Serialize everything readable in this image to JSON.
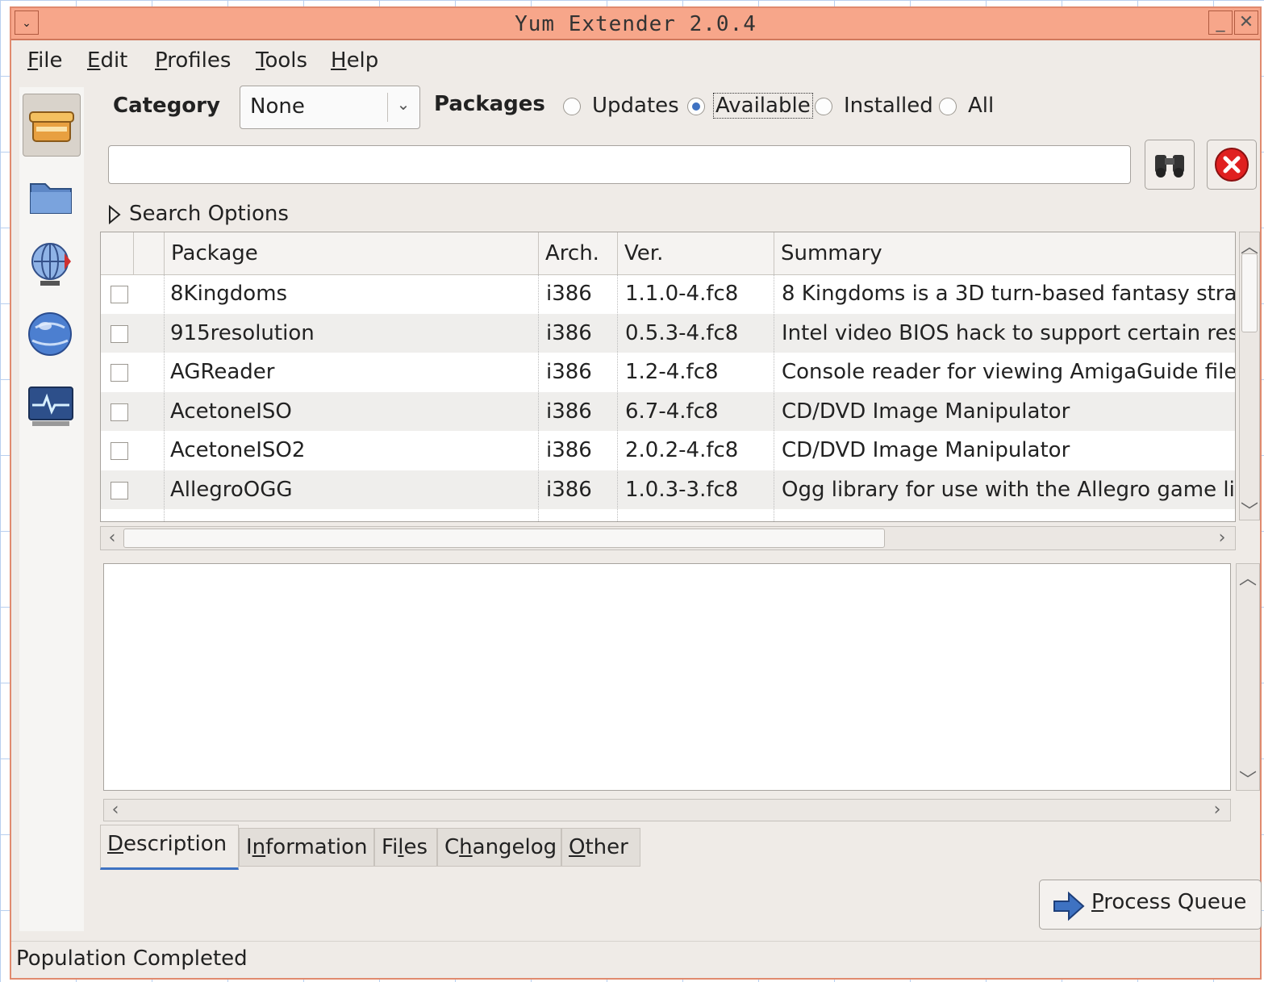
{
  "window": {
    "title": "Yum Extender 2.0.4",
    "menu_glyph": "⌄",
    "minimize_glyph": "_",
    "close_glyph": "✕"
  },
  "menubar": {
    "items": [
      {
        "label": "File",
        "mnemonic": "F",
        "rest": "ile"
      },
      {
        "label": "Edit",
        "mnemonic": "E",
        "rest": "dit"
      },
      {
        "label": "Profiles",
        "mnemonic": "P",
        "rest": "rofiles"
      },
      {
        "label": "Tools",
        "mnemonic": "T",
        "rest": "ools"
      },
      {
        "label": "Help",
        "mnemonic": "H",
        "rest": "elp"
      }
    ]
  },
  "sidebar": {
    "items": [
      {
        "name": "packages",
        "icon": "package-box-icon",
        "active": true
      },
      {
        "name": "groups",
        "icon": "folder-icon",
        "active": false
      },
      {
        "name": "repositories",
        "icon": "repository-globe-icon",
        "active": false
      },
      {
        "name": "queue",
        "icon": "globe-icon",
        "active": false
      },
      {
        "name": "output",
        "icon": "monitor-output-icon",
        "active": false
      }
    ]
  },
  "filters": {
    "category_label": "Category",
    "category_value": "None",
    "packages_label": "Packages",
    "radios": [
      {
        "label": "Updates",
        "selected": false
      },
      {
        "label": "Available",
        "selected": true
      },
      {
        "label": "Installed",
        "selected": false
      },
      {
        "label": "All",
        "selected": false
      }
    ]
  },
  "search": {
    "value": "",
    "search_icon": "binoculars-icon",
    "clear_icon": "clear-red-x-icon"
  },
  "search_options": {
    "label": "Search Options"
  },
  "package_table": {
    "columns": [
      "Package",
      "Arch.",
      "Ver.",
      "Summary"
    ],
    "rows": [
      {
        "package": "8Kingdoms",
        "arch": "i386",
        "ver": "1.1.0-4.fc8",
        "summary": "8 Kingdoms is a 3D turn-based fantasy stra"
      },
      {
        "package": "915resolution",
        "arch": "i386",
        "ver": "0.5.3-4.fc8",
        "summary": "Intel video BIOS hack to support certain res"
      },
      {
        "package": "AGReader",
        "arch": "i386",
        "ver": "1.2-4.fc8",
        "summary": "Console reader for viewing AmigaGuide files"
      },
      {
        "package": "AcetoneISO",
        "arch": "i386",
        "ver": "6.7-4.fc8",
        "summary": "CD/DVD Image Manipulator"
      },
      {
        "package": "AcetoneISO2",
        "arch": "i386",
        "ver": "2.0.2-4.fc8",
        "summary": "CD/DVD Image Manipulator"
      },
      {
        "package": "AllegroOGG",
        "arch": "i386",
        "ver": "1.0.3-3.fc8",
        "summary": "Ogg library for use with the Allegro game lib"
      }
    ]
  },
  "detail_tabs": [
    {
      "label": "Description",
      "pre": "",
      "mnemonic": "D",
      "post": "escription",
      "active": true
    },
    {
      "label": "Information",
      "pre": "I",
      "mnemonic": "n",
      "post": "formation",
      "active": false
    },
    {
      "label": "Files",
      "pre": "Fi",
      "mnemonic": "l",
      "post": "es",
      "active": false
    },
    {
      "label": "Changelog",
      "pre": "C",
      "mnemonic": "h",
      "post": "angelog",
      "active": false
    },
    {
      "label": "Other",
      "pre": "",
      "mnemonic": "O",
      "post": "ther",
      "active": false
    }
  ],
  "process_button": {
    "label": "Process Queue",
    "mnemonic": "P",
    "rest": "rocess Queue",
    "icon": "arrow-right-icon"
  },
  "status": {
    "text": "Population Completed"
  },
  "colors": {
    "titlebar": "#f7a68a",
    "accent": "#3e72c2",
    "window_bg": "#efebe7",
    "clear_red": "#e02020"
  }
}
